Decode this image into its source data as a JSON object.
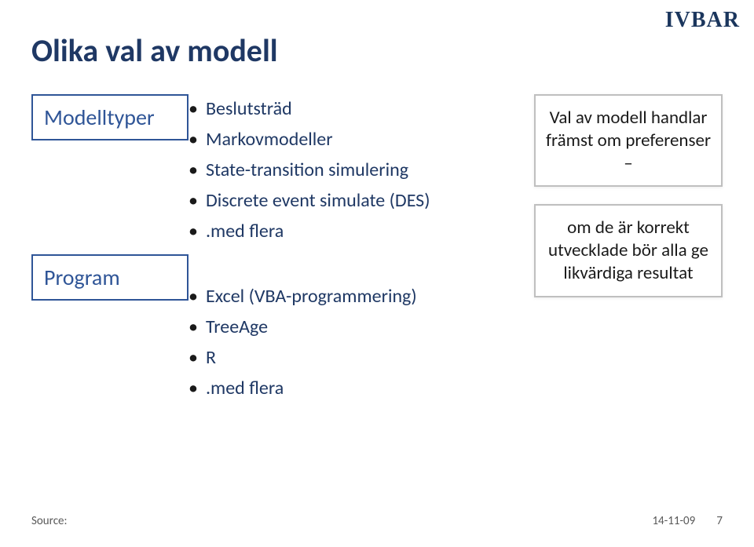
{
  "logo": "IVBAR",
  "title": "Olika val av modell",
  "leftLabels": {
    "modelltyper": "Modelltyper",
    "program": "Program"
  },
  "lists": {
    "modelltyper": [
      "Beslutsträd",
      "Markovmodeller",
      "State-transition simulering",
      "Discrete event simulate (DES)",
      ".med flera"
    ],
    "program": [
      "Excel (VBA-programmering)",
      "TreeAge",
      "R",
      ".med flera"
    ]
  },
  "callouts": {
    "c1": "Val av modell handlar främst om preferenser –",
    "c2": "om de är korrekt utvecklade bör alla ge likvärdiga resultat"
  },
  "footer": {
    "source": "Source:",
    "date": "14-11-09",
    "page": "7"
  }
}
